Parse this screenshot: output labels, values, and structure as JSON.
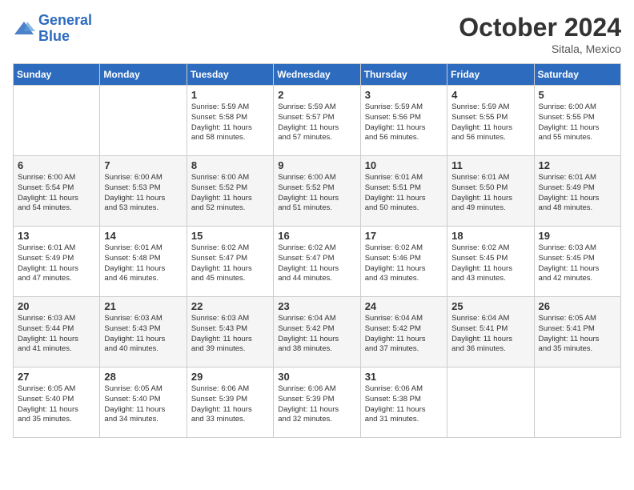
{
  "header": {
    "logo_line1": "General",
    "logo_line2": "Blue",
    "month": "October 2024",
    "location": "Sitala, Mexico"
  },
  "days_of_week": [
    "Sunday",
    "Monday",
    "Tuesday",
    "Wednesday",
    "Thursday",
    "Friday",
    "Saturday"
  ],
  "weeks": [
    [
      {
        "day": "",
        "info": ""
      },
      {
        "day": "",
        "info": ""
      },
      {
        "day": "1",
        "info": "Sunrise: 5:59 AM\nSunset: 5:58 PM\nDaylight: 11 hours\nand 58 minutes."
      },
      {
        "day": "2",
        "info": "Sunrise: 5:59 AM\nSunset: 5:57 PM\nDaylight: 11 hours\nand 57 minutes."
      },
      {
        "day": "3",
        "info": "Sunrise: 5:59 AM\nSunset: 5:56 PM\nDaylight: 11 hours\nand 56 minutes."
      },
      {
        "day": "4",
        "info": "Sunrise: 5:59 AM\nSunset: 5:55 PM\nDaylight: 11 hours\nand 56 minutes."
      },
      {
        "day": "5",
        "info": "Sunrise: 6:00 AM\nSunset: 5:55 PM\nDaylight: 11 hours\nand 55 minutes."
      }
    ],
    [
      {
        "day": "6",
        "info": "Sunrise: 6:00 AM\nSunset: 5:54 PM\nDaylight: 11 hours\nand 54 minutes."
      },
      {
        "day": "7",
        "info": "Sunrise: 6:00 AM\nSunset: 5:53 PM\nDaylight: 11 hours\nand 53 minutes."
      },
      {
        "day": "8",
        "info": "Sunrise: 6:00 AM\nSunset: 5:52 PM\nDaylight: 11 hours\nand 52 minutes."
      },
      {
        "day": "9",
        "info": "Sunrise: 6:00 AM\nSunset: 5:52 PM\nDaylight: 11 hours\nand 51 minutes."
      },
      {
        "day": "10",
        "info": "Sunrise: 6:01 AM\nSunset: 5:51 PM\nDaylight: 11 hours\nand 50 minutes."
      },
      {
        "day": "11",
        "info": "Sunrise: 6:01 AM\nSunset: 5:50 PM\nDaylight: 11 hours\nand 49 minutes."
      },
      {
        "day": "12",
        "info": "Sunrise: 6:01 AM\nSunset: 5:49 PM\nDaylight: 11 hours\nand 48 minutes."
      }
    ],
    [
      {
        "day": "13",
        "info": "Sunrise: 6:01 AM\nSunset: 5:49 PM\nDaylight: 11 hours\nand 47 minutes."
      },
      {
        "day": "14",
        "info": "Sunrise: 6:01 AM\nSunset: 5:48 PM\nDaylight: 11 hours\nand 46 minutes."
      },
      {
        "day": "15",
        "info": "Sunrise: 6:02 AM\nSunset: 5:47 PM\nDaylight: 11 hours\nand 45 minutes."
      },
      {
        "day": "16",
        "info": "Sunrise: 6:02 AM\nSunset: 5:47 PM\nDaylight: 11 hours\nand 44 minutes."
      },
      {
        "day": "17",
        "info": "Sunrise: 6:02 AM\nSunset: 5:46 PM\nDaylight: 11 hours\nand 43 minutes."
      },
      {
        "day": "18",
        "info": "Sunrise: 6:02 AM\nSunset: 5:45 PM\nDaylight: 11 hours\nand 43 minutes."
      },
      {
        "day": "19",
        "info": "Sunrise: 6:03 AM\nSunset: 5:45 PM\nDaylight: 11 hours\nand 42 minutes."
      }
    ],
    [
      {
        "day": "20",
        "info": "Sunrise: 6:03 AM\nSunset: 5:44 PM\nDaylight: 11 hours\nand 41 minutes."
      },
      {
        "day": "21",
        "info": "Sunrise: 6:03 AM\nSunset: 5:43 PM\nDaylight: 11 hours\nand 40 minutes."
      },
      {
        "day": "22",
        "info": "Sunrise: 6:03 AM\nSunset: 5:43 PM\nDaylight: 11 hours\nand 39 minutes."
      },
      {
        "day": "23",
        "info": "Sunrise: 6:04 AM\nSunset: 5:42 PM\nDaylight: 11 hours\nand 38 minutes."
      },
      {
        "day": "24",
        "info": "Sunrise: 6:04 AM\nSunset: 5:42 PM\nDaylight: 11 hours\nand 37 minutes."
      },
      {
        "day": "25",
        "info": "Sunrise: 6:04 AM\nSunset: 5:41 PM\nDaylight: 11 hours\nand 36 minutes."
      },
      {
        "day": "26",
        "info": "Sunrise: 6:05 AM\nSunset: 5:41 PM\nDaylight: 11 hours\nand 35 minutes."
      }
    ],
    [
      {
        "day": "27",
        "info": "Sunrise: 6:05 AM\nSunset: 5:40 PM\nDaylight: 11 hours\nand 35 minutes."
      },
      {
        "day": "28",
        "info": "Sunrise: 6:05 AM\nSunset: 5:40 PM\nDaylight: 11 hours\nand 34 minutes."
      },
      {
        "day": "29",
        "info": "Sunrise: 6:06 AM\nSunset: 5:39 PM\nDaylight: 11 hours\nand 33 minutes."
      },
      {
        "day": "30",
        "info": "Sunrise: 6:06 AM\nSunset: 5:39 PM\nDaylight: 11 hours\nand 32 minutes."
      },
      {
        "day": "31",
        "info": "Sunrise: 6:06 AM\nSunset: 5:38 PM\nDaylight: 11 hours\nand 31 minutes."
      },
      {
        "day": "",
        "info": ""
      },
      {
        "day": "",
        "info": ""
      }
    ]
  ]
}
